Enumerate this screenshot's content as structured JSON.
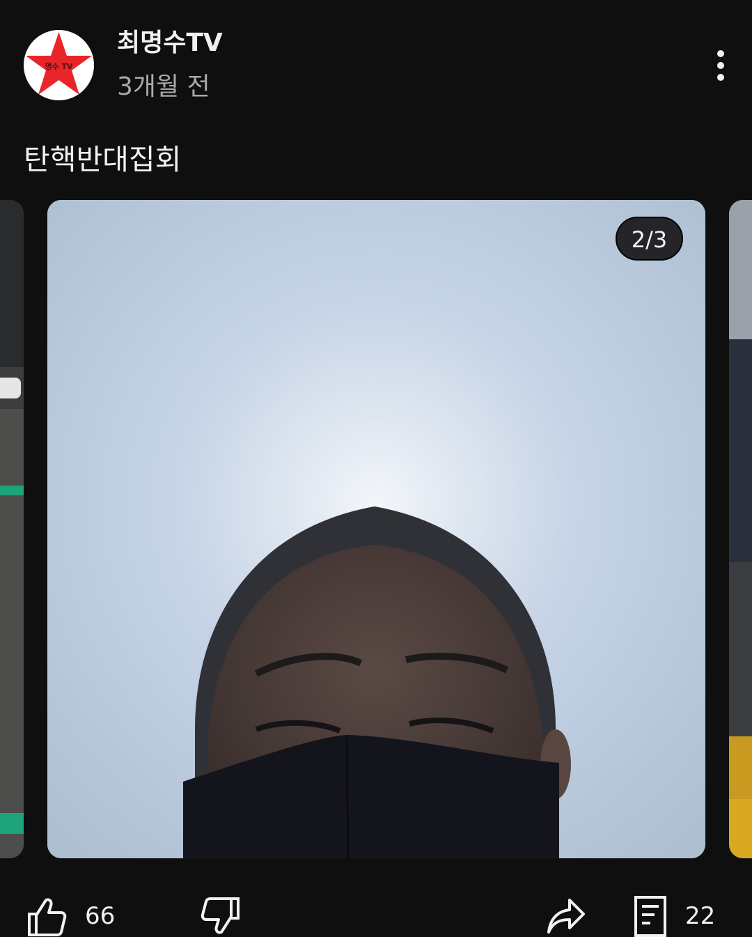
{
  "post": {
    "channel_name": "최명수TV",
    "time_ago": "3개월 전",
    "text": "탄핵반대집회",
    "avatar": {
      "logo_text": "명수 TV",
      "star_color": "#e8262a",
      "background": "#ffffff"
    }
  },
  "carousel": {
    "counter": "2/3",
    "current_index": 2,
    "total": 3
  },
  "actions": {
    "like_count": "66",
    "comment_count": "22"
  },
  "icons": {
    "more": "more-vert-icon",
    "like": "thumb-up-icon",
    "dislike": "thumb-down-icon",
    "share": "share-icon",
    "comment": "comment-icon"
  },
  "colors": {
    "background": "#0f0f0f",
    "text_primary": "#f1f1f1",
    "text_secondary": "#aaaaaa"
  }
}
